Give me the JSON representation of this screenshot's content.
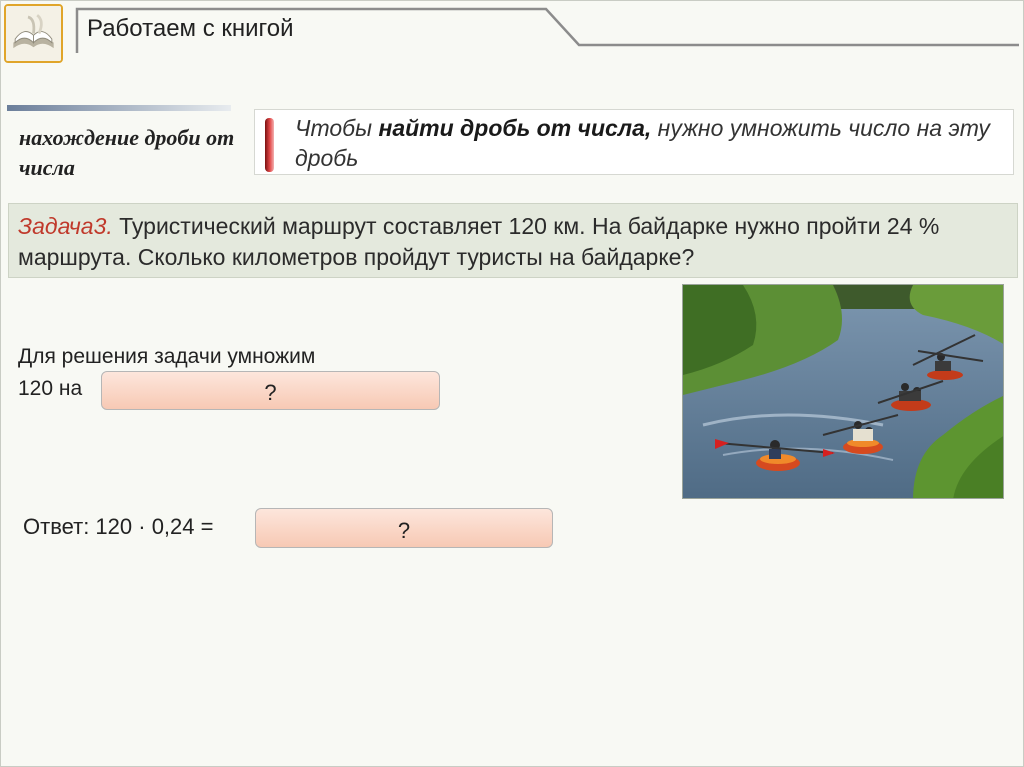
{
  "header": {
    "title": "Работаем с книгой",
    "logo_icon": "open-book-icon"
  },
  "rule": {
    "side_label": "нахождение дроби от числа",
    "text_before": "Чтобы ",
    "text_bold": "найти дробь от числа,",
    "text_after": " нужно умножить число на эту дробь"
  },
  "task": {
    "label": "Задача3.",
    "text": " Туристический маршрут составляет 120 км. На байдарке нужно пройти 24 % маршрута. Сколько километров пройдут туристы на байдарке?"
  },
  "photo": {
    "icon": "kayaks-on-river-photo"
  },
  "solution": {
    "line1": "Для решения задачи умножим",
    "line2": "120 на",
    "box1_text": "?",
    "answer_label": "Ответ: 120 · 0,24 =",
    "box2_text": "?"
  },
  "colors": {
    "accent_red": "#c0392b",
    "task_bg": "#e4e9dd",
    "answer_box": "#f7c9b4",
    "logo_border": "#e0a52a"
  }
}
